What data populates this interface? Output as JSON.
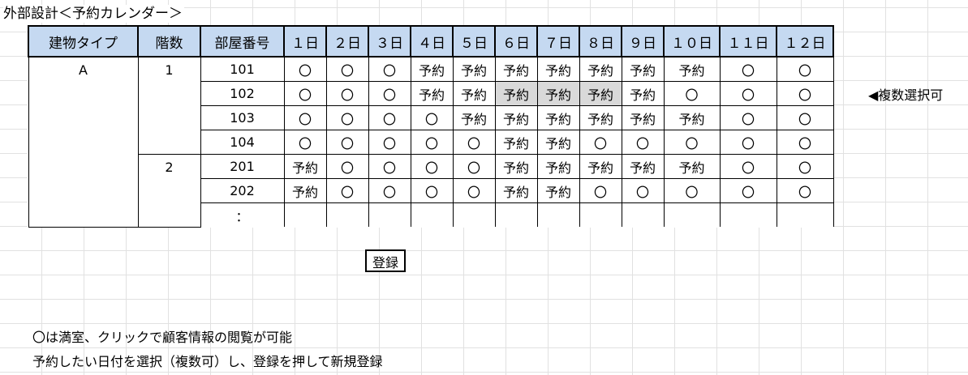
{
  "title": "外部設計＜予約カレンダー＞",
  "table": {
    "headers": [
      "建物タイプ",
      "階数",
      "部屋番号",
      "１日",
      "２日",
      "３日",
      "４日",
      "５日",
      "６日",
      "７日",
      "８日",
      "９日",
      "１０日",
      "１１日",
      "１２日"
    ],
    "building_type": "A",
    "floors": [
      {
        "floor": "1",
        "rooms": [
          {
            "room": "101",
            "days": [
              "〇",
              "〇",
              "〇",
              "予約",
              "予約",
              "予約",
              "予約",
              "予約",
              "予約",
              "予約",
              "〇",
              "〇"
            ]
          },
          {
            "room": "102",
            "days": [
              "〇",
              "〇",
              "〇",
              "予約",
              "予約",
              "予約",
              "予約",
              "予約",
              "予約",
              "〇",
              "〇",
              "〇"
            ]
          },
          {
            "room": "103",
            "days": [
              "〇",
              "〇",
              "〇",
              "〇",
              "予約",
              "予約",
              "予約",
              "予約",
              "予約",
              "予約",
              "〇",
              "〇"
            ]
          },
          {
            "room": "104",
            "days": [
              "〇",
              "〇",
              "〇",
              "〇",
              "〇",
              "予約",
              "予約",
              "〇",
              "〇",
              "〇",
              "〇",
              "〇"
            ]
          }
        ]
      },
      {
        "floor": "2",
        "rooms": [
          {
            "room": "201",
            "days": [
              "予約",
              "〇",
              "〇",
              "〇",
              "〇",
              "予約",
              "予約",
              "予約",
              "予約",
              "予約",
              "〇",
              "〇"
            ]
          },
          {
            "room": "202",
            "days": [
              "予約",
              "〇",
              "〇",
              "〇",
              "〇",
              "予約",
              "予約",
              "〇",
              "〇",
              "〇",
              "〇",
              "〇"
            ]
          },
          {
            "room": "：",
            "days": [
              "",
              "",
              "",
              "",
              "",
              "",
              "",
              "",
              "",
              "",
              "",
              ""
            ]
          }
        ]
      }
    ],
    "selected_cells": [
      {
        "row": 1,
        "day": 5
      },
      {
        "row": 1,
        "day": 6
      },
      {
        "row": 1,
        "day": 7
      }
    ],
    "colors": {
      "header_bg": "#c5d9f1",
      "selected_bg": "#d9d9d9"
    }
  },
  "side_note": "◀複数選択可",
  "register_button": "登録",
  "footnotes": [
    "〇は満室、クリックで顧客情報の閲覧が可能",
    "予約したい日付を選択（複数可）し、登録を押して新規登録"
  ]
}
